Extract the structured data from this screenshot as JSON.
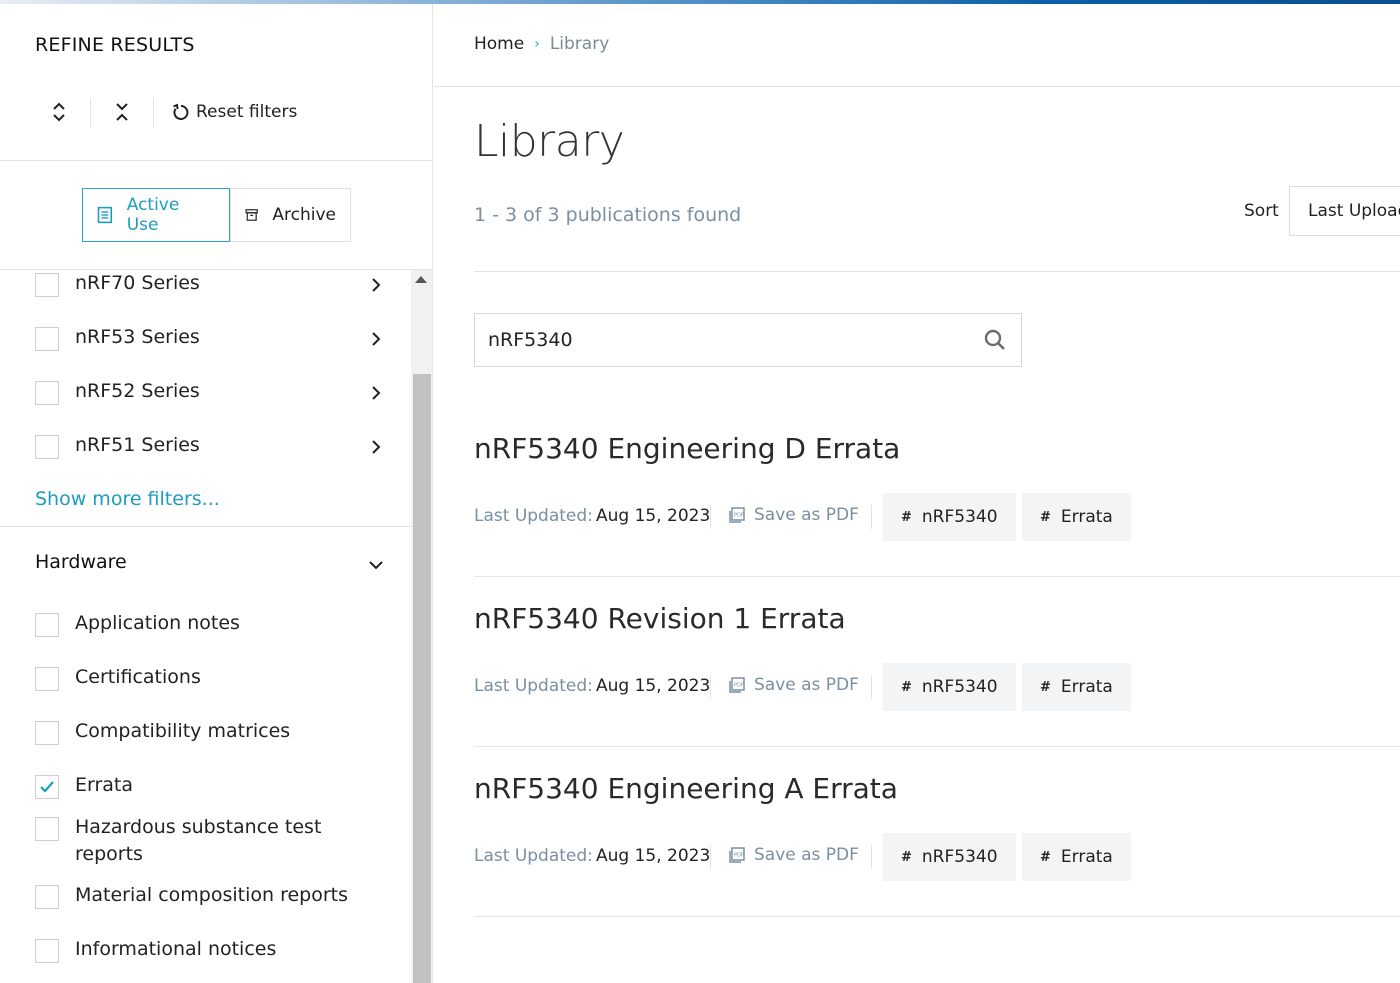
{
  "sidebar": {
    "title": "REFINE RESULTS",
    "reset_label": "Reset filters",
    "segments": [
      {
        "label": "Active Use",
        "icon": "document-icon",
        "active": true
      },
      {
        "label": "Archive",
        "icon": "archive-icon",
        "active": false
      }
    ],
    "series_filters": [
      {
        "label": "nRF70 Series",
        "checked": false
      },
      {
        "label": "nRF53 Series",
        "checked": false
      },
      {
        "label": "nRF52 Series",
        "checked": false
      },
      {
        "label": "nRF51 Series",
        "checked": false
      }
    ],
    "show_more": "Show more filters...",
    "hardware": {
      "title": "Hardware",
      "items": [
        {
          "label": "Application notes",
          "checked": false
        },
        {
          "label": "Certifications",
          "checked": false
        },
        {
          "label": "Compatibility matrices",
          "checked": false
        },
        {
          "label": "Errata",
          "checked": true
        },
        {
          "label": "Hazardous substance test reports",
          "checked": false
        },
        {
          "label": "Material composition reports",
          "checked": false
        },
        {
          "label": "Informational notices",
          "checked": false
        }
      ]
    }
  },
  "main": {
    "breadcrumb": {
      "home": "Home",
      "separator": "›",
      "current": "Library"
    },
    "title": "Library",
    "count": "1 - 3 of 3 publications found",
    "sort_label": "Sort",
    "sort_value": "Last Uploaded",
    "search": {
      "value": "nRF5340"
    },
    "results": [
      {
        "title": "nRF5340 Engineering D Errata",
        "updated_label": "Last Updated:",
        "updated": "Aug 15, 2023",
        "pdf_label": "Save as PDF",
        "tags": [
          "nRF5340",
          "Errata"
        ]
      },
      {
        "title": "nRF5340 Revision 1 Errata",
        "updated_label": "Last Updated:",
        "updated": "Aug 15, 2023",
        "pdf_label": "Save as PDF",
        "tags": [
          "nRF5340",
          "Errata"
        ]
      },
      {
        "title": "nRF5340 Engineering A Errata",
        "updated_label": "Last Updated:",
        "updated": "Aug 15, 2023",
        "pdf_label": "Save as PDF",
        "tags": [
          "nRF5340",
          "Errata"
        ]
      }
    ]
  },
  "colors": {
    "accent": "#1d9cc2",
    "muted": "#7a8fa3",
    "tag_bg": "#f3f4f5"
  }
}
